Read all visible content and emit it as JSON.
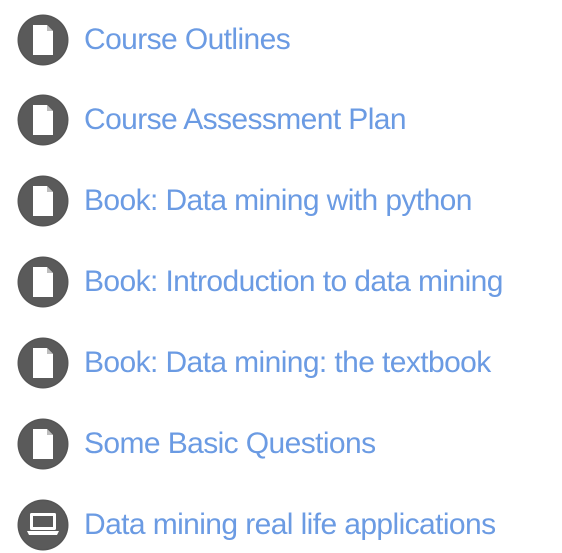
{
  "colors": {
    "link": "#6b9be3",
    "icon_ring": "#555555",
    "icon_fill": "#ffffff"
  },
  "resources": [
    {
      "label": "Course Outlines",
      "icon": "document-icon"
    },
    {
      "label": "Course Assessment Plan",
      "icon": "document-icon"
    },
    {
      "label": "Book: Data mining with python",
      "icon": "document-icon"
    },
    {
      "label": "Book: Introduction to data mining",
      "icon": "document-icon"
    },
    {
      "label": "Book: Data mining: the textbook",
      "icon": "document-icon"
    },
    {
      "label": "Some Basic Questions",
      "icon": "document-icon"
    },
    {
      "label": "Data mining real life applications",
      "icon": "laptop-icon"
    }
  ]
}
